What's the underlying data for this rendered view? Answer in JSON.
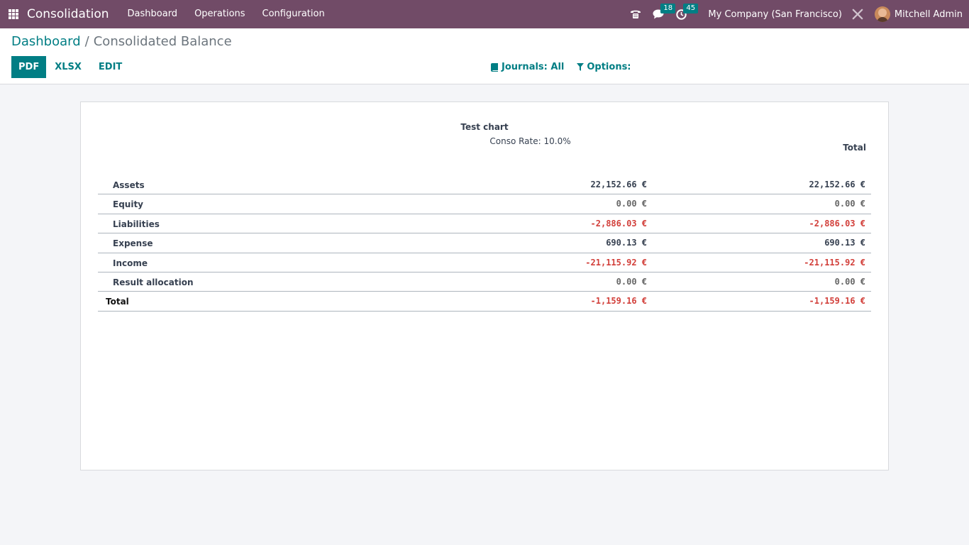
{
  "navbar": {
    "brand": "Consolidation",
    "menu": [
      "Dashboard",
      "Operations",
      "Configuration"
    ],
    "chat_count": "18",
    "activity_count": "45",
    "company": "My Company (San Francisco)",
    "user": "Mitchell Admin"
  },
  "breadcrumb": {
    "parent": "Dashboard",
    "separator": "/",
    "current": "Consolidated Balance"
  },
  "buttons": {
    "pdf": "PDF",
    "xlsx": "XLSX",
    "edit": "EDIT"
  },
  "filters": {
    "journals": "Journals: All",
    "options": "Options:"
  },
  "report": {
    "chart_title": "Test chart",
    "conso_rate": "Conso Rate: 10.0%",
    "total_header": "Total",
    "rows": [
      {
        "label": "Assets",
        "value": "22,152.66 €",
        "total": "22,152.66 €",
        "sign": "pos"
      },
      {
        "label": "Equity",
        "value": "0.00 €",
        "total": "0.00 €",
        "sign": "zero"
      },
      {
        "label": "Liabilities",
        "value": "-2,886.03 €",
        "total": "-2,886.03 €",
        "sign": "neg"
      },
      {
        "label": "Expense",
        "value": "690.13 €",
        "total": "690.13 €",
        "sign": "pos"
      },
      {
        "label": "Income",
        "value": "-21,115.92 €",
        "total": "-21,115.92 €",
        "sign": "neg"
      },
      {
        "label": "Result allocation",
        "value": "0.00 €",
        "total": "0.00 €",
        "sign": "zero"
      },
      {
        "label": "Total",
        "value": "-1,159.16 €",
        "total": "-1,159.16 €",
        "sign": "neg"
      }
    ]
  },
  "colors": {
    "navbar": "#714b67",
    "accent": "#017e84",
    "negative": "#d23f3a"
  }
}
